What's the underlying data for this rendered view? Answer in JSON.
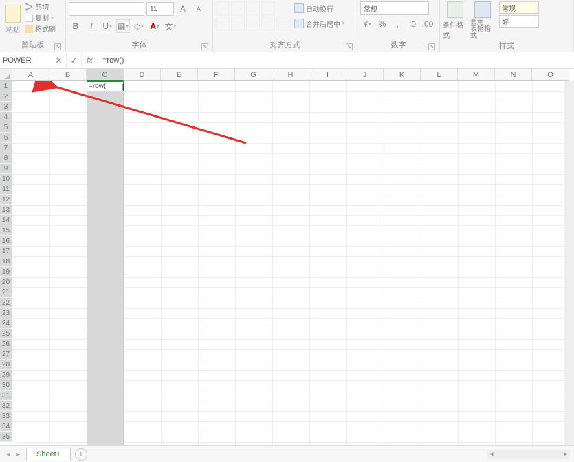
{
  "ribbon": {
    "clipboard": {
      "title": "剪贴板",
      "paste": "粘贴",
      "cut": "剪切",
      "copy": "复制",
      "format_painter": "格式刷"
    },
    "font": {
      "title": "字体",
      "size": "11"
    },
    "alignment": {
      "title": "对齐方式",
      "wrap": "自动换行",
      "merge": "合并后居中"
    },
    "number": {
      "title": "数字",
      "format": "常规"
    },
    "styles": {
      "title": "样式",
      "conditional": "条件格式",
      "table": "套用\n表格格式",
      "normal": "常规",
      "good": "好"
    }
  },
  "namebox": "POWER",
  "formula": "=row()",
  "active_cell_value": "=row(",
  "columns": [
    "A",
    "B",
    "C",
    "D",
    "E",
    "F",
    "G",
    "H",
    "I",
    "J",
    "K",
    "L",
    "M",
    "N",
    "O"
  ],
  "rows_visible": 35,
  "selected_column_index": 2,
  "sheet_tab": "Sheet1"
}
